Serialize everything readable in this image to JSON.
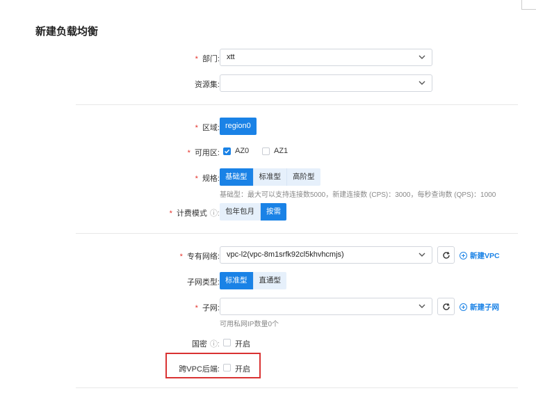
{
  "page_title": "新建负载均衡",
  "form": {
    "department": {
      "label": "部门:",
      "value": "xtt"
    },
    "resource_set": {
      "label": "资源集:",
      "value": ""
    },
    "region": {
      "label": "区域:",
      "value": "region0"
    },
    "availability_zone": {
      "label": "可用区:",
      "options": [
        {
          "label": "AZ0",
          "checked": true
        },
        {
          "label": "AZ1",
          "checked": false
        }
      ]
    },
    "spec": {
      "label": "规格:",
      "options": [
        "基础型",
        "标准型",
        "高阶型"
      ],
      "selected": "基础型",
      "hint": "基础型：最大可以支持连接数5000，新建连接数 (CPS)：3000，每秒查询数 (QPS)：1000"
    },
    "billing": {
      "label": "计费模式",
      "help": "ⓘ:",
      "options": [
        "包年包月",
        "按需"
      ],
      "selected": "按需"
    },
    "vpc": {
      "label": "专有网络:",
      "value": "vpc-l2(vpc-8m1srfk92cl5khvhcmjs)",
      "new_link": "新建VPC"
    },
    "subnet_type": {
      "label": "子网类型:",
      "options": [
        "标准型",
        "直通型"
      ],
      "selected": "标准型"
    },
    "subnet": {
      "label": "子网:",
      "value": "",
      "new_link": "新建子网",
      "hint": "可用私网IP数量0个"
    },
    "gm": {
      "label": "国密",
      "help": "ⓘ:",
      "option": "开启",
      "checked": false
    },
    "cross_vpc": {
      "label": "跨VPC后端:",
      "option": "开启",
      "checked": false
    }
  },
  "colors": {
    "primary": "#1a82e6",
    "required": "#e5312a",
    "highlight": "#d93232"
  }
}
